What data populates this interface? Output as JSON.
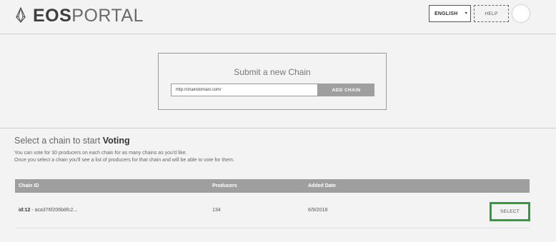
{
  "header": {
    "logo_icon": "eos-logo-icon",
    "logo_bold": "EOS",
    "logo_thin": "PORTAL",
    "language": "ENGLISH",
    "language_caret": "▾",
    "help_label": "HELP"
  },
  "submit": {
    "title": "Submit a new Chain",
    "input_value": "http://chaindomain.com/",
    "button_label": "ADD CHAIN"
  },
  "select_section": {
    "title_prefix": "Select a chain to start ",
    "title_bold": "Voting",
    "desc_1": "You can vote for 30 producers on each chain for as many chains as you'd like.",
    "desc_2": "Once you select a chain you'll see a list of producers for that chain and will be able to vote for them."
  },
  "table": {
    "headers": [
      "Chain ID",
      "Producers",
      "Added Date"
    ],
    "rows": [
      {
        "id_label": "id:12",
        "chain_id": " - aca376f206b8fc2...",
        "producers": "134",
        "added_date": "6/9/2018",
        "action": "SELECT"
      }
    ]
  },
  "colors": {
    "background": "#f3f3f3",
    "table_header": "#9f9f9f",
    "select_highlight": "#2e9e3a"
  }
}
